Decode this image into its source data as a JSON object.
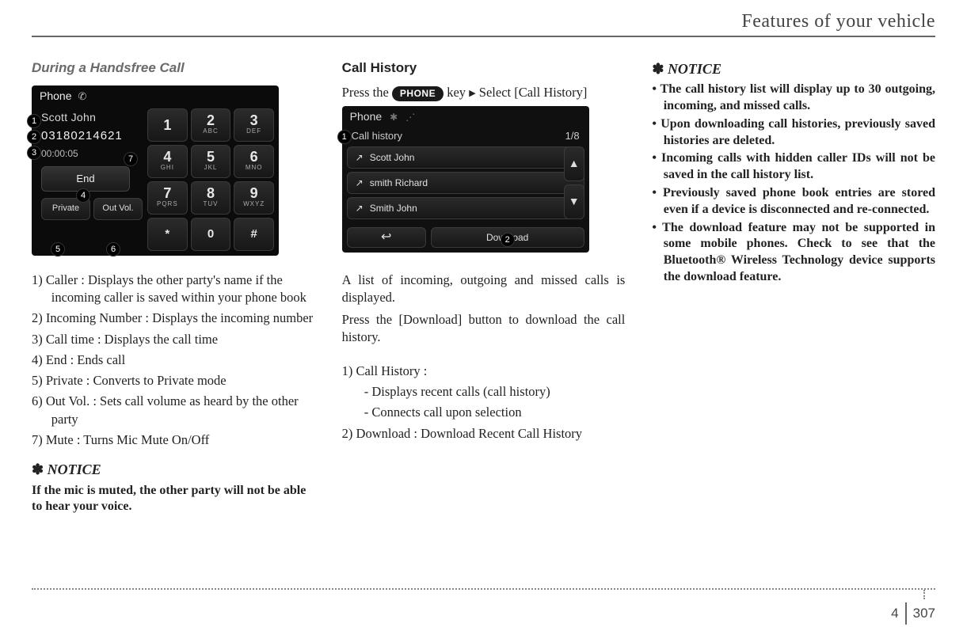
{
  "header": {
    "title": "Features of your vehicle"
  },
  "footer": {
    "chapter": "4",
    "page": "307"
  },
  "col1": {
    "title": "During a Handsfree Call",
    "list": {
      "i1": "1) Caller : Displays the other party's name if the incoming caller is saved within your phone book",
      "i2": "2) Incoming Number : Displays the incoming number",
      "i3": "3) Call time : Displays the call time",
      "i4": "4) End : Ends call",
      "i5": "5) Private : Converts to Private mode",
      "i6": "6) Out Vol. : Sets call volume as heard by the other party",
      "i7": "7) Mute : Turns Mic Mute On/Off"
    },
    "noticeTitle": "NOTICE",
    "noticeBody": "If the mic is muted, the other party will not be able to hear your voice."
  },
  "col2": {
    "title": "Call History",
    "pressPre": "Press the ",
    "keyLabel": "PHONE",
    "pressMid": " key ",
    "pressPost": " Select [Call History]",
    "body1": "A list of incoming, outgoing and missed calls is displayed.",
    "body2": "Press the [Download] button to download the call history.",
    "list": {
      "i1": "1) Call History :",
      "i1a": "- Displays recent calls (call history)",
      "i1b": "- Connects call upon selection",
      "i2": "2) Download : Download Recent Call History"
    }
  },
  "col3": {
    "noticeTitle": "NOTICE",
    "bullets": {
      "b1": "• The call history list will display up to 30 outgoing, incoming, and missed calls.",
      "b2": "• Upon downloading call histories, previously saved histories are deleted.",
      "b3": "• Incoming calls with hidden caller IDs will not be saved in the call history list.",
      "b4": "• Previously saved phone book entries are stored even if a device is disconnected and re-connected.",
      "b5": "• The download feature may not be supported in some mobile phones. Check to see that the Bluetooth® Wireless Technology device supports the download feature."
    }
  },
  "screen1": {
    "header": "Phone",
    "caller": "Scott John",
    "number": "03180214621",
    "time": "00:00:05",
    "end": "End",
    "private": "Private",
    "outvol": "Out Vol.",
    "keys": {
      "1": {
        "big": "1",
        "sm": ""
      },
      "2": {
        "big": "2",
        "sm": "ABC"
      },
      "3": {
        "big": "3",
        "sm": "DEF"
      },
      "4": {
        "big": "4",
        "sm": "GHI"
      },
      "5": {
        "big": "5",
        "sm": "JKL"
      },
      "6": {
        "big": "6",
        "sm": "MNO"
      },
      "7": {
        "big": "7",
        "sm": "PQRS"
      },
      "8": {
        "big": "8",
        "sm": "TUV"
      },
      "9": {
        "big": "9",
        "sm": "WXYZ"
      },
      "ast": "*",
      "zero": "0",
      "hash": "#"
    },
    "callouts": {
      "c1": "1",
      "c2": "2",
      "c3": "3",
      "c4": "4",
      "c5": "5",
      "c6": "6",
      "c7": "7"
    }
  },
  "screen2": {
    "header": "Phone",
    "subhead": "Call history",
    "pageind": "1/8",
    "rows": {
      "r1": "Scott John",
      "r2": "smith Richard",
      "r3": "Smith John"
    },
    "back": "↩",
    "download": "Download",
    "callouts": {
      "c1": "1",
      "c2": "2"
    }
  }
}
